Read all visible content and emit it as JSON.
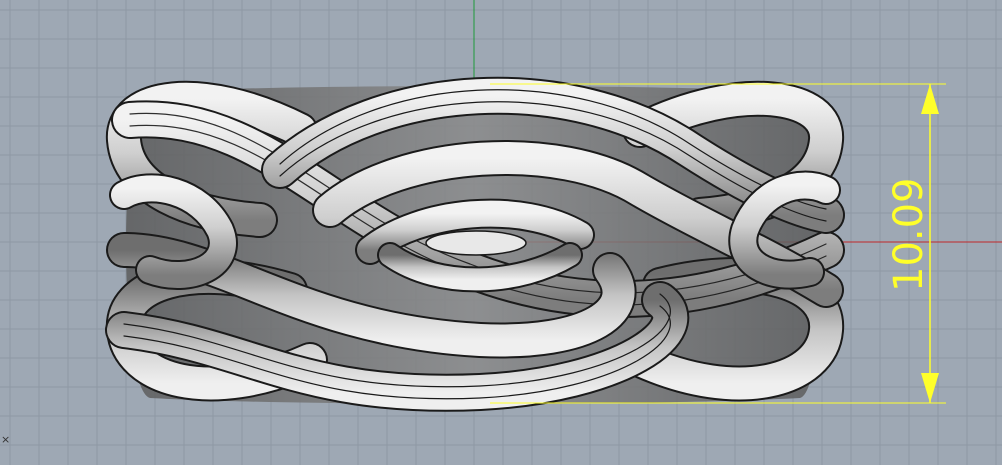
{
  "viewport": {
    "background_color": "#9ea8b4",
    "grid_color": "#8e98a4",
    "x_axis_color": "#c0282a",
    "y_axis_color": "#1f9a3a"
  },
  "dimension": {
    "value_label": "10.09",
    "color": "#ffff2a"
  },
  "model": {
    "shaded_color": "#c8c8c8",
    "shadow_color": "#7a7a7a",
    "edge_color": "#1a1a1a"
  },
  "corner_marker": "×"
}
